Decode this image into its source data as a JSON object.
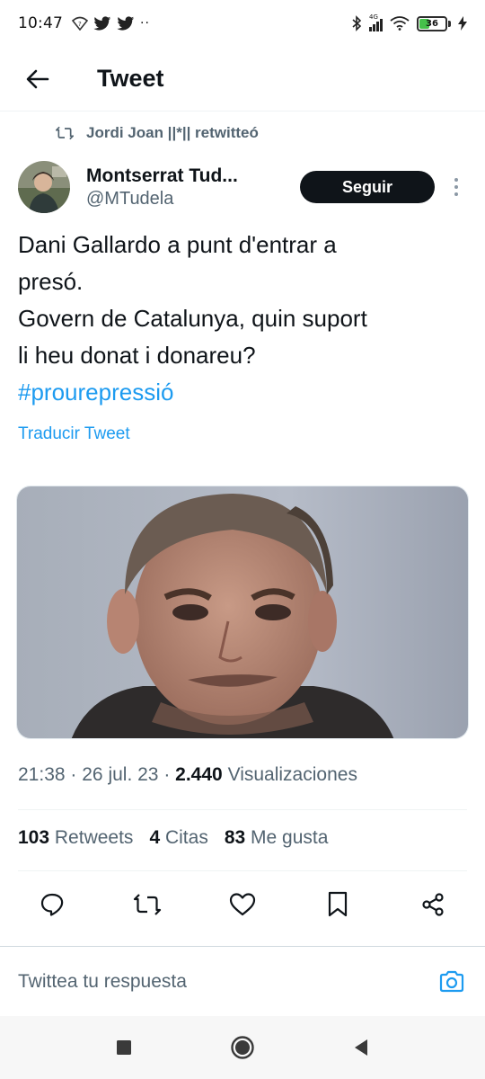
{
  "status_bar": {
    "time": "10:47",
    "left_icons": [
      "wifi-question-icon",
      "twitter-bird-icon",
      "twitter-bird-icon",
      "more-dots-icon"
    ],
    "network_label": "4G",
    "battery_level": 36,
    "battery_text": "36"
  },
  "header": {
    "title": "Tweet",
    "back_icon": "arrow-left-icon"
  },
  "retweet": {
    "icon": "retweet-icon",
    "text": "Jordi Joan ||*|| retwitteó"
  },
  "author": {
    "name": "Montserrat Tud...",
    "handle": "@MTudela",
    "follow_label": "Seguir"
  },
  "tweet": {
    "lines": [
      "Dani Gallardo a punt d'entrar a",
      "presó.",
      "Govern de Catalunya, quin suport",
      "li heu donat i donareu?"
    ],
    "hashtag": "#prourepressió",
    "translate_label": "Traducir Tweet"
  },
  "meta": {
    "time": "21:38",
    "sep1": "·",
    "date": "26 jul. 23",
    "sep2": "·",
    "views_count": "2.440",
    "views_label": "Visualizaciones"
  },
  "stats": {
    "retweets_count": "103",
    "retweets_label": "Retweets",
    "quotes_count": "4",
    "quotes_label": "Citas",
    "likes_count": "83",
    "likes_label": "Me gusta"
  },
  "actions": [
    "reply-icon",
    "retweet-icon",
    "like-icon",
    "bookmark-icon",
    "share-icon"
  ],
  "reply_bar": {
    "placeholder": "Twittea tu respuesta",
    "camera_icon": "camera-icon"
  },
  "nav": [
    "recents-square-icon",
    "home-circle-icon",
    "back-triangle-icon"
  ],
  "colors": {
    "accent": "#1d9bf0",
    "text_primary": "#0f1419",
    "text_secondary": "#536471",
    "follow_bg": "#0f1419",
    "battery_fill": "#45c04a"
  }
}
